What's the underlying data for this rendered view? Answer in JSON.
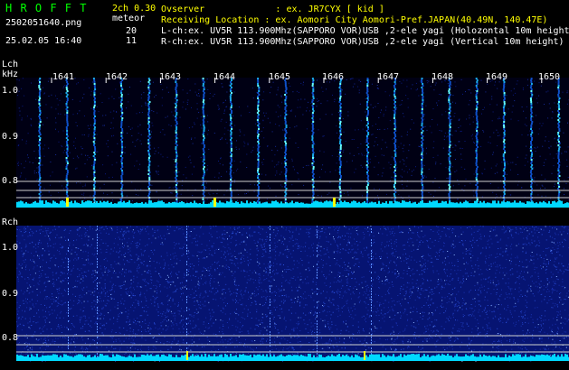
{
  "header": {
    "app_name": "H R O F F T",
    "version": "2ch 0.30",
    "filename": "2502051640.png",
    "mode_label": "meteor",
    "lch_count": "20",
    "rch_count": "11",
    "datetime": "25.02.05 16:40",
    "observer": "Ovserver             : ex. JR7CYX [ kid ]",
    "location": "Receiving Location : ex. Aomori City Aomori-Pref.JAPAN(40.49N, 140.47E)",
    "lch_info": "L-ch:ex. UV5R 113.900Mhz(SAPPORO VOR)USB ,2-ele yagi (Holozontal 10m height)",
    "rch_info": "R-ch:ex. UV5R 113.900Mhz(SAPPORO VOR)USB ,2-ele yagi (Vertical 10m height)"
  },
  "lch": {
    "label": "Lch",
    "unit": "kHz",
    "ticks": [
      "1.0",
      "0.9",
      "0.8"
    ]
  },
  "rch": {
    "label": "Rch",
    "ticks": [
      "1.0",
      "0.9",
      "0.8"
    ]
  },
  "time_labels": [
    "1641",
    "1642",
    "1643",
    "1644",
    "1645",
    "1646",
    "1647",
    "1648",
    "1649",
    "1650"
  ],
  "colors": {
    "background": "#000000",
    "title_green": "#00ff00",
    "info_cyan": "#00ffff",
    "spectrum_dark": "#0b1c8a",
    "spectrum_bright": "#00e0ff",
    "guide_line": "#ffffff",
    "marker_yellow": "#ffff00"
  }
}
